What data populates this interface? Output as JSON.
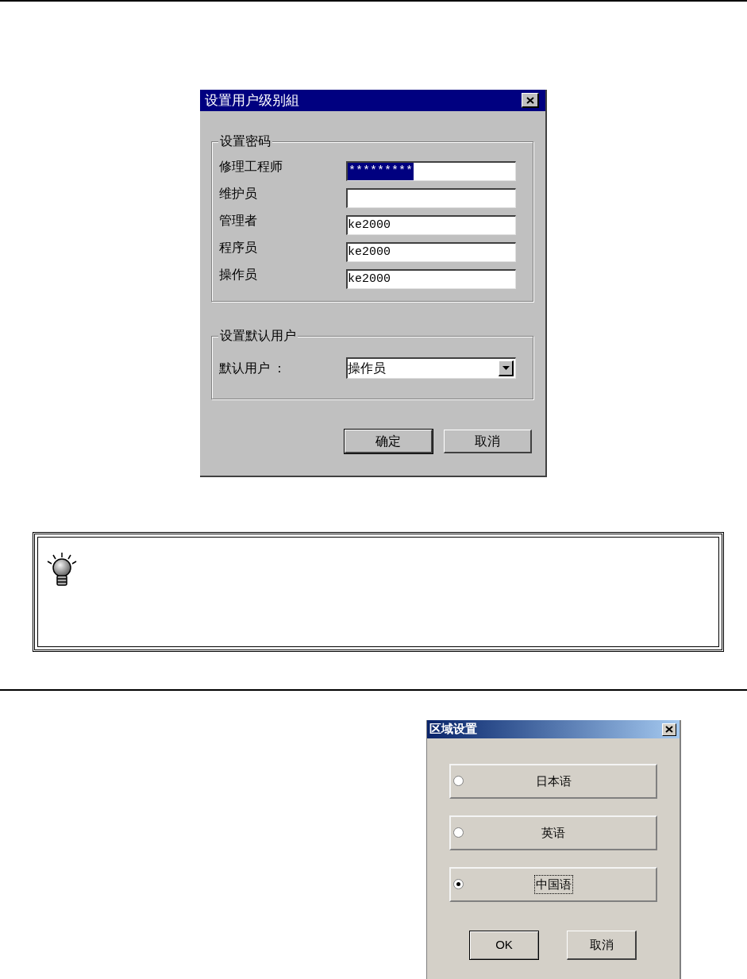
{
  "user_level_dialog": {
    "title": "设置用户级别組",
    "password_group": {
      "title": "设置密码",
      "fields": [
        {
          "label": "修理工程师",
          "value": "*********",
          "text_selected": true
        },
        {
          "label": "维护员",
          "text_selected": false
        },
        {
          "label": "管理者",
          "value": "ke2000",
          "text_selected": false
        },
        {
          "label": "程序员",
          "value": "ke2000",
          "text_selected": false
        },
        {
          "label": "操作员",
          "value": "ke2000",
          "text_selected": false
        }
      ]
    },
    "default_user_group": {
      "title": "设置默认用户",
      "label": "默认用户 ：",
      "value": "操作员"
    },
    "buttons": [
      {
        "label": "确定",
        "default": true
      },
      {
        "label": "取消",
        "default": false
      }
    ]
  },
  "region_dialog": {
    "title": "区域设置",
    "options": [
      {
        "label": "日本语",
        "selected": false
      },
      {
        "label": "英语",
        "selected": false
      },
      {
        "label": "中国语",
        "selected": true
      }
    ],
    "buttons": [
      {
        "label": "OK",
        "default": true
      },
      {
        "label": "取消",
        "default": false
      }
    ]
  }
}
